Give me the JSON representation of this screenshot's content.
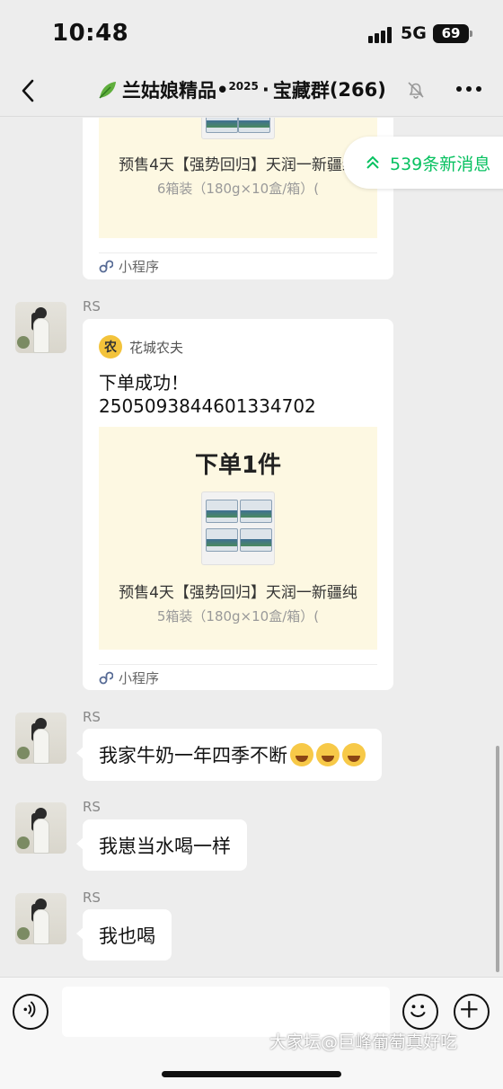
{
  "status_bar": {
    "time": "10:48",
    "network": "5G",
    "battery": "69"
  },
  "nav": {
    "title_main": "兰姑娘精品",
    "title_dot1": "•",
    "title_sup": "2025",
    "title_dot2": "·",
    "title_rest": "宝藏群",
    "member_count": "(266)"
  },
  "new_messages": {
    "label": "539条新消息"
  },
  "messages": [
    {
      "type": "mini-program-partial",
      "product_title": "预售4天【强势回归】天润一新疆纯",
      "product_spec": "6箱装（180g×10盒/箱）(",
      "footer": "小程序"
    },
    {
      "type": "mini-program",
      "sender": "RS",
      "app_name": "花城农夫",
      "text_line1": "下单成功！",
      "text_line2": "2505093844601334702",
      "heading": "下单1件",
      "product_title": "预售4天【强势回归】天润一新疆纯",
      "product_spec": "5箱装（180g×10盒/箱）(",
      "footer": "小程序"
    },
    {
      "type": "text",
      "sender": "RS",
      "text": "我家牛奶一年四季不断"
    },
    {
      "type": "text",
      "sender": "RS",
      "text": "我崽当水喝一样"
    },
    {
      "type": "text",
      "sender": "RS",
      "text": "我也喝"
    }
  ],
  "input": {
    "placeholder": ""
  },
  "watermark": "大家坛@巨峰葡萄真好吃",
  "colors": {
    "accent": "#07c160",
    "background": "#ededed",
    "card": "#ffffff",
    "mini_bg": "#fdf8e2"
  }
}
